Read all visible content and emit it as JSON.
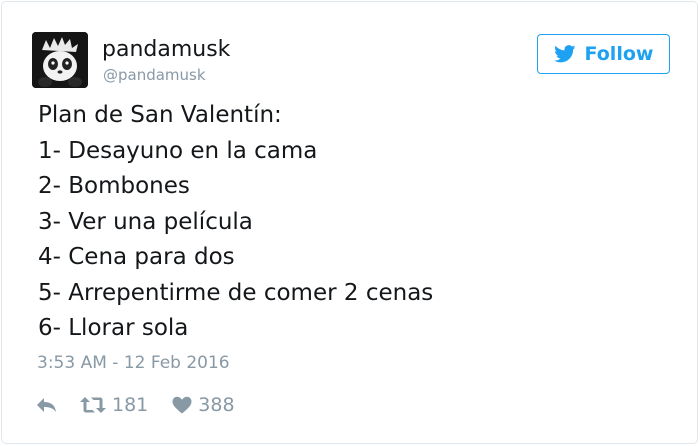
{
  "user": {
    "name": "pandamusk",
    "handle": "@pandamusk"
  },
  "follow_button": {
    "label": "Follow",
    "icon": "twitter-bird-icon",
    "color": "#1da1f2"
  },
  "tweet": {
    "lines": [
      "Plan de San Valentín:",
      "1- Desayuno en la cama",
      "2- Bombones",
      "3- Ver una película",
      "4- Cena para dos",
      "5- Arrepentirme de comer 2 cenas",
      "6- Llorar sola"
    ],
    "timestamp": "3:53 AM - 12 Feb 2016"
  },
  "actions": {
    "reply_icon": "reply-icon",
    "retweet_icon": "retweet-icon",
    "retweets": "181",
    "like_icon": "heart-icon",
    "likes": "388"
  }
}
